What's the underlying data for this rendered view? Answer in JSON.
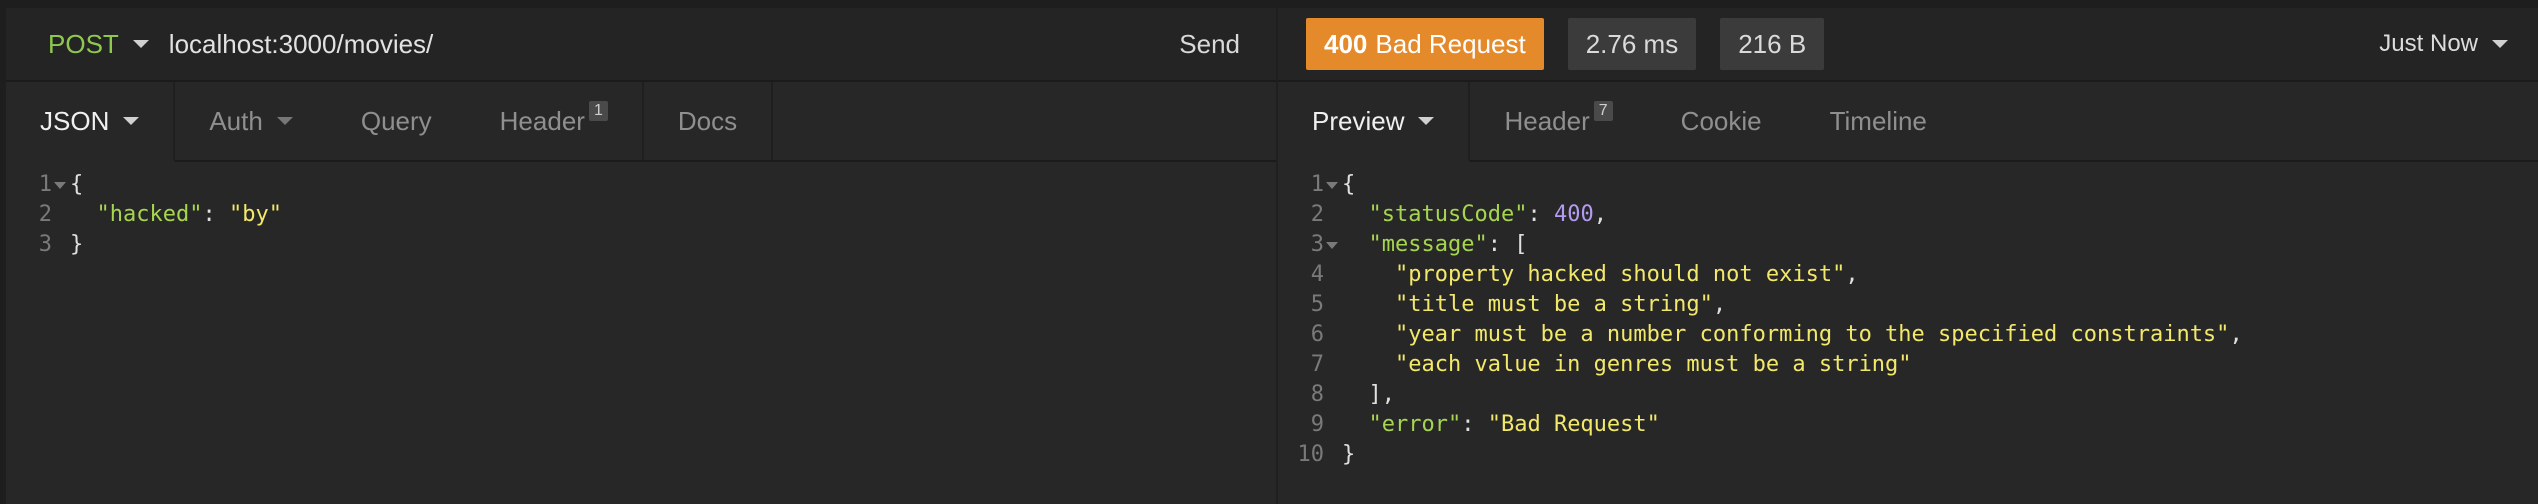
{
  "request": {
    "method": "POST",
    "url": "localhost:3000/movies/",
    "send_label": "Send",
    "tabs": [
      {
        "label": "JSON",
        "active": true,
        "dropdown": true
      },
      {
        "label": "Auth",
        "active": false,
        "dropdown": true
      },
      {
        "label": "Query",
        "active": false
      },
      {
        "label": "Header",
        "badge": "1",
        "active": false
      },
      {
        "label": "Docs",
        "active": false
      }
    ],
    "body_lines": [
      {
        "num": "1",
        "fold": true,
        "tokens": [
          {
            "t": "p",
            "v": "{"
          }
        ]
      },
      {
        "num": "2",
        "fold": false,
        "tokens": [
          {
            "t": "p",
            "v": "  "
          },
          {
            "t": "k",
            "v": "\"hacked\""
          },
          {
            "t": "p",
            "v": ": "
          },
          {
            "t": "s",
            "v": "\"by\""
          }
        ]
      },
      {
        "num": "3",
        "fold": false,
        "tokens": [
          {
            "t": "p",
            "v": "}"
          }
        ]
      }
    ]
  },
  "response": {
    "status_code": "400",
    "status_text": "Bad Request",
    "time": "2.76 ms",
    "size": "216 B",
    "time_menu_label": "Just Now",
    "tabs": [
      {
        "label": "Preview",
        "active": true,
        "dropdown": true
      },
      {
        "label": "Header",
        "badge": "7",
        "active": false
      },
      {
        "label": "Cookie",
        "active": false
      },
      {
        "label": "Timeline",
        "active": false
      }
    ],
    "body_lines": [
      {
        "num": "1",
        "fold": true,
        "tokens": [
          {
            "t": "p",
            "v": "{"
          }
        ]
      },
      {
        "num": "2",
        "fold": false,
        "tokens": [
          {
            "t": "p",
            "v": "  "
          },
          {
            "t": "k",
            "v": "\"statusCode\""
          },
          {
            "t": "p",
            "v": ": "
          },
          {
            "t": "n",
            "v": "400"
          },
          {
            "t": "p",
            "v": ","
          }
        ]
      },
      {
        "num": "3",
        "fold": true,
        "tokens": [
          {
            "t": "p",
            "v": "  "
          },
          {
            "t": "k",
            "v": "\"message\""
          },
          {
            "t": "p",
            "v": ": ["
          }
        ]
      },
      {
        "num": "4",
        "fold": false,
        "tokens": [
          {
            "t": "p",
            "v": "    "
          },
          {
            "t": "s",
            "v": "\"property hacked should not exist\""
          },
          {
            "t": "p",
            "v": ","
          }
        ]
      },
      {
        "num": "5",
        "fold": false,
        "tokens": [
          {
            "t": "p",
            "v": "    "
          },
          {
            "t": "s",
            "v": "\"title must be a string\""
          },
          {
            "t": "p",
            "v": ","
          }
        ]
      },
      {
        "num": "6",
        "fold": false,
        "tokens": [
          {
            "t": "p",
            "v": "    "
          },
          {
            "t": "s",
            "v": "\"year must be a number conforming to the specified constraints\""
          },
          {
            "t": "p",
            "v": ","
          }
        ]
      },
      {
        "num": "7",
        "fold": false,
        "tokens": [
          {
            "t": "p",
            "v": "    "
          },
          {
            "t": "s",
            "v": "\"each value in genres must be a string\""
          }
        ]
      },
      {
        "num": "8",
        "fold": false,
        "tokens": [
          {
            "t": "p",
            "v": "  ],"
          }
        ]
      },
      {
        "num": "9",
        "fold": false,
        "tokens": [
          {
            "t": "p",
            "v": "  "
          },
          {
            "t": "k",
            "v": "\"error\""
          },
          {
            "t": "p",
            "v": ": "
          },
          {
            "t": "s",
            "v": "\"Bad Request\""
          }
        ]
      },
      {
        "num": "10",
        "fold": false,
        "tokens": [
          {
            "t": "p",
            "v": "}"
          }
        ]
      }
    ]
  },
  "colors": {
    "method": "#8ec94f",
    "status_badge": "#e58a2a",
    "json_key": "#a6d64f",
    "json_string": "#f2e86a",
    "json_number": "#b49bf0"
  }
}
